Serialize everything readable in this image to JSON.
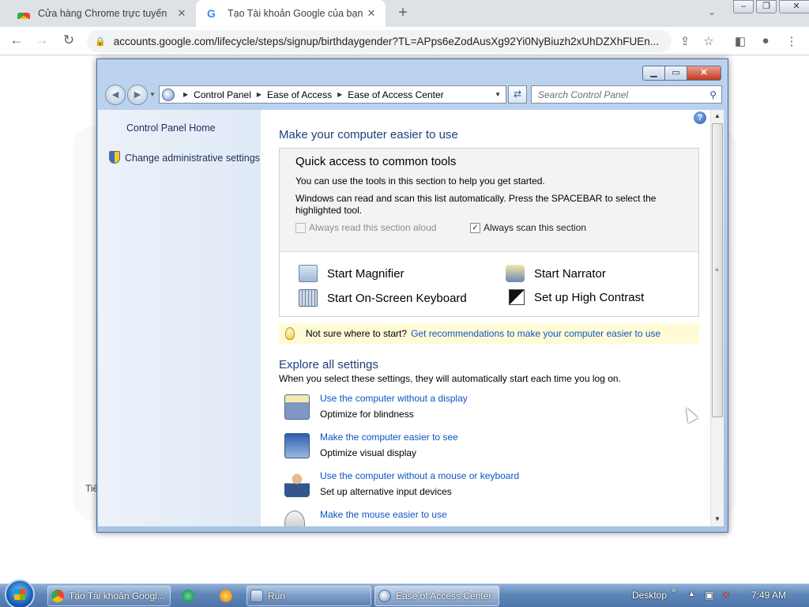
{
  "browser": {
    "tabs": [
      {
        "title": "Cửa hàng Chrome trực tuyến",
        "active": false
      },
      {
        "title": "Tạo Tài khoản Google của bạn",
        "active": true
      }
    ],
    "url": "accounts.google.com/lifecycle/steps/signup/birthdaygender?TL=APps6eZodAusXg92Yi0NyBiuzh2xUhDZXhFUEn...",
    "page_footer_fragment": "Tiế"
  },
  "explorer": {
    "breadcrumb": [
      "Control Panel",
      "Ease of Access",
      "Ease of Access Center"
    ],
    "search_placeholder": "Search Control Panel",
    "left_pane": {
      "home": "Control Panel Home",
      "admin": "Change administrative settings"
    },
    "main": {
      "heading": "Make your computer easier to use",
      "quick": {
        "title": "Quick access to common tools",
        "line1": "You can use the tools in this section to help you get started.",
        "line2a": "Windows can read and scan this list automatically.  Press the SPACEBAR to select the",
        "line2b": "highlighted tool.",
        "read_aloud": "Always read this section aloud",
        "read_aloud_checked": false,
        "scan": "Always scan this section",
        "scan_checked": true,
        "tools": [
          "Start Magnifier",
          "Start Narrator",
          "Start On-Screen Keyboard",
          "Set up High Contrast"
        ]
      },
      "tip": {
        "question": "Not sure where to start?",
        "link": "Get recommendations to make your computer easier to use"
      },
      "explore": {
        "title": "Explore all settings",
        "subtitle": "When you select these settings, they will automatically start each time you log on.",
        "items": [
          {
            "title": "Use the computer without a display",
            "desc": "Optimize for blindness"
          },
          {
            "title": "Make the computer easier to see",
            "desc": "Optimize visual display"
          },
          {
            "title": "Use the computer without a mouse or keyboard",
            "desc": "Set up alternative input devices"
          },
          {
            "title": "Make the mouse easier to use",
            "desc": ""
          }
        ]
      }
    }
  },
  "taskbar": {
    "buttons": [
      "Tạo Tài khoản Googl...",
      "Run",
      "Ease of Access Center"
    ],
    "desktop_label": "Desktop",
    "clock": "7:49 AM"
  },
  "colors": {
    "link": "#0d55c4",
    "heading": "#1e3f7a",
    "tip_background": "#fffbd6",
    "taskbar": "#5f86b8"
  }
}
